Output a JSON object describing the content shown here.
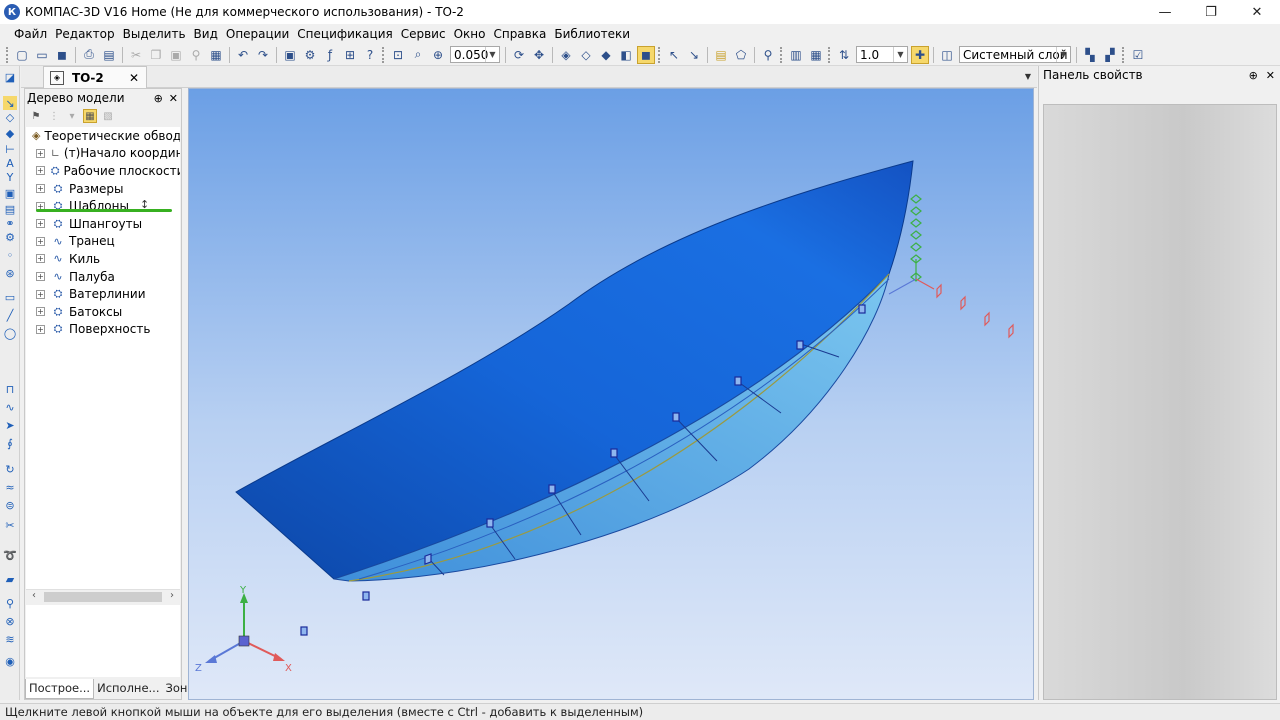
{
  "window": {
    "title": "КОМПАС-3D V16 Home  (Не для коммерческого использования) - ТО-2",
    "app_icon": "kompas-logo-icon",
    "controls": {
      "minimize": "—",
      "maximize": "❐",
      "close": "✕"
    }
  },
  "menu": {
    "items": [
      "Файл",
      "Редактор",
      "Выделить",
      "Вид",
      "Операции",
      "Спецификация",
      "Сервис",
      "Окно",
      "Справка",
      "Библиотеки"
    ]
  },
  "toolbar": {
    "zoom_value": "0.050",
    "step_value": "1.0",
    "layer_value": "Системный слой"
  },
  "document_tab": {
    "label": "ТО-2",
    "close": "✕"
  },
  "model_tree": {
    "title": "Дерево модели",
    "pin": "⊕",
    "close": "✕",
    "root": {
      "label": "Теоретические обводь",
      "icon": "part-icon"
    },
    "children": [
      {
        "label": "(т)Начало координа",
        "icon": "origin-icon"
      },
      {
        "label": "Рабочие плоскости",
        "icon": "group-icon"
      },
      {
        "label": "Размеры",
        "icon": "group-icon"
      },
      {
        "label": "Шаблоны",
        "icon": "group-icon"
      },
      {
        "label": "Шпангоуты",
        "icon": "group-icon"
      },
      {
        "label": "Транец",
        "icon": "curve-icon"
      },
      {
        "label": "Киль",
        "icon": "curve-icon"
      },
      {
        "label": "Палуба",
        "icon": "curve-icon"
      },
      {
        "label": "Ватерлинии",
        "icon": "group-icon"
      },
      {
        "label": "Батоксы",
        "icon": "group-icon"
      },
      {
        "label": "Поверхность",
        "icon": "group-icon"
      }
    ],
    "expander_symbol": "+",
    "tabs": [
      "Построе...",
      "Исполне...",
      "Зоны"
    ],
    "active_tab": 0
  },
  "viewport": {
    "axes": {
      "x": "X",
      "y": "Y",
      "z": "Z"
    },
    "colors": {
      "hull": "#1565d8",
      "hull_dark": "#0d47a8",
      "bottom": "#5ab0e8",
      "axis_x": "#e05a5a",
      "axis_y": "#3cb044",
      "axis_z": "#5a78d6"
    }
  },
  "properties_panel": {
    "title": "Панель свойств",
    "pin": "⊕",
    "close": "✕"
  },
  "status": {
    "text": "Щелкните левой кнопкой мыши на объекте для его выделения (вместе с Ctrl - добавить к выделенным)"
  }
}
